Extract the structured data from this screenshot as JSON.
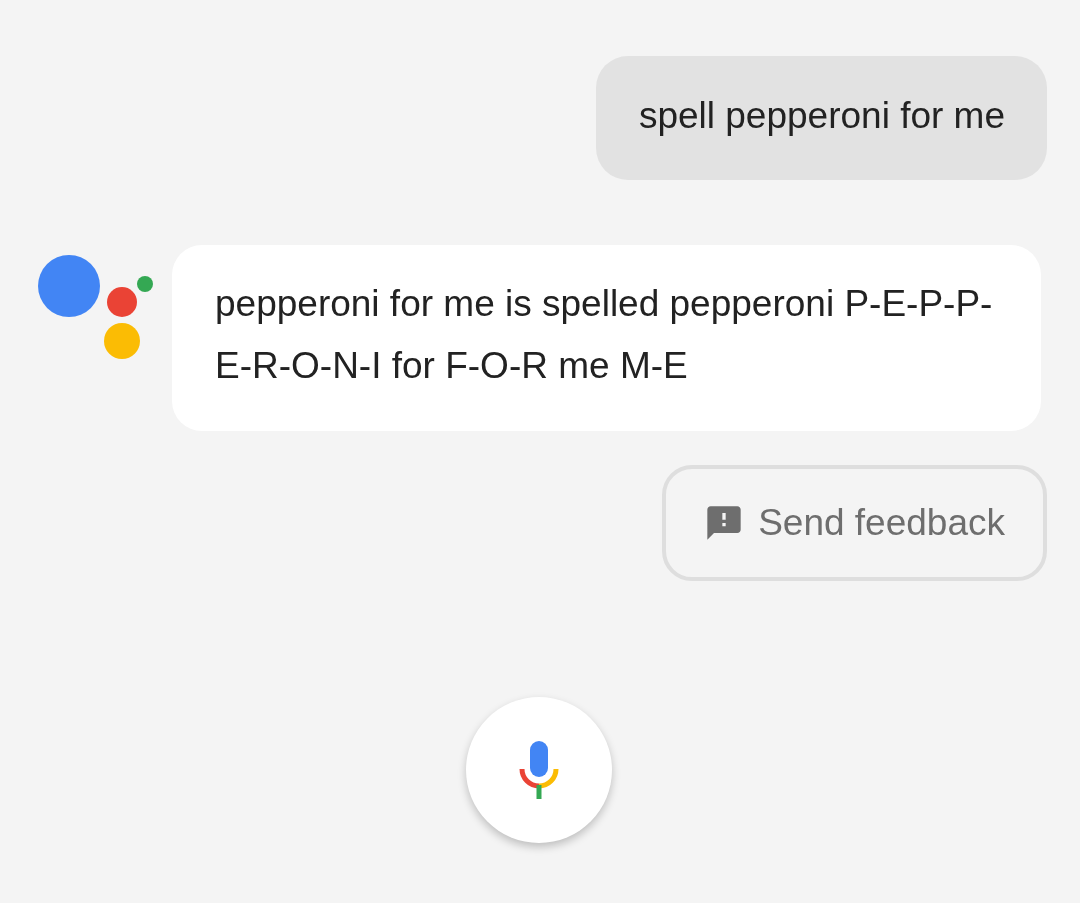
{
  "user_message": {
    "text": "spell pepperoni for me"
  },
  "assistant_message": {
    "text": "pepperoni for me is spelled pepperoni P-E-P-P-E-R-O-N-I for F-O-R me M-E"
  },
  "feedback_button": {
    "label": "Send feedback"
  }
}
